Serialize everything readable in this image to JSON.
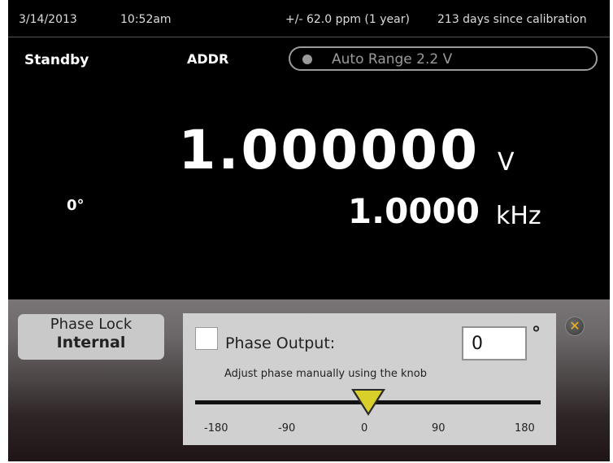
{
  "status": {
    "date": "3/14/2013",
    "time": "10:52am",
    "spec": "+/- 62.0 ppm (1 year)",
    "calibration": "213 days since calibration"
  },
  "header": {
    "mode": "Standby",
    "addr_label": "ADDR",
    "range_label": "Auto Range 2.2 V"
  },
  "readout": {
    "amplitude_value": "1.000000",
    "amplitude_unit": "V",
    "phase_value": "0°",
    "frequency_value": "1.0000",
    "frequency_unit": "kHz"
  },
  "phase_lock": {
    "title": "Phase Lock",
    "value": "Internal"
  },
  "phase_dialog": {
    "checkbox_label": "Phase Output:",
    "input_value": "0",
    "degree_symbol": "°",
    "help_text": "Adjust phase manually using the knob",
    "slider_ticks": [
      "-180",
      "-90",
      "0",
      "90",
      "180"
    ],
    "slider_value": 0,
    "slider_min": -180,
    "slider_max": 180,
    "close_icon": "close-x-icon"
  },
  "colors": {
    "background": "#000000",
    "panel": "#d0d0d0",
    "slider_thumb": "#d9cf2a",
    "close_icon": "#f2b322"
  }
}
